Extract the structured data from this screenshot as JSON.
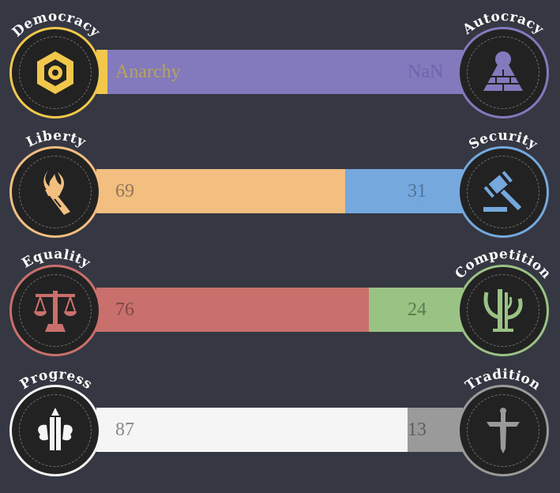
{
  "axes": [
    {
      "left": {
        "name": "Democracy",
        "color": "#f1c84b",
        "icon": "hexagon-gear-icon"
      },
      "right": {
        "name": "Autocracy",
        "color": "#8379bd",
        "icon": "pyramid-eye-icon"
      },
      "left_value": "Anarchy",
      "right_value": "NaN",
      "left_fraction": 0.0,
      "left_value_color": "#b9a35a",
      "right_value_color": "#6e66ad"
    },
    {
      "left": {
        "name": "Liberty",
        "color": "#f2bf80",
        "icon": "torch-icon"
      },
      "right": {
        "name": "Security",
        "color": "#75a9de",
        "icon": "gavel-icon"
      },
      "left_value": "69",
      "right_value": "31",
      "left_fraction": 0.69,
      "left_value_color": "#8f7659",
      "right_value_color": "#4f7397"
    },
    {
      "left": {
        "name": "Equality",
        "color": "#c9706c",
        "icon": "scales-icon"
      },
      "right": {
        "name": "Competition",
        "color": "#9ac284",
        "icon": "trident-icon"
      },
      "left_value": "76",
      "right_value": "24",
      "left_fraction": 0.76,
      "left_value_color": "#7c4a47",
      "right_value_color": "#5c7a4e"
    },
    {
      "left": {
        "name": "Progress",
        "color": "#f5f5f5",
        "icon": "rocket-icon"
      },
      "right": {
        "name": "Tradition",
        "color": "#9a9a9a",
        "icon": "sword-icon"
      },
      "left_value": "87",
      "right_value": "13",
      "left_fraction": 0.87,
      "left_value_color": "#888888",
      "right_value_color": "#5e5e5e"
    }
  ]
}
